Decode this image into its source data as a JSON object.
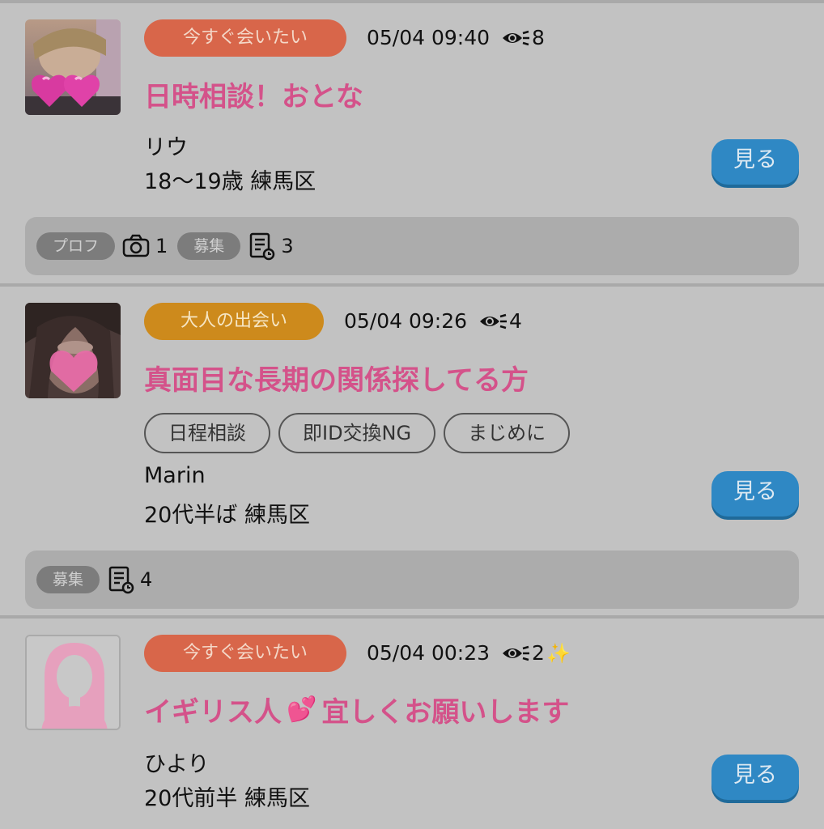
{
  "posts": [
    {
      "avatar": "photo-hearts-avatar",
      "category": "今すぐ会いたい",
      "datetime": "05/04 09:40",
      "views": "8",
      "title": "日時相談！おとな",
      "tags": [],
      "name": "リウ",
      "sub": "18〜19歳 練馬区",
      "button": "見る",
      "footer": {
        "profile_label": "プロフ",
        "photo_count": "1",
        "recruit_label": "募集",
        "post_count": "3"
      }
    },
    {
      "avatar": "photo-heart-avatar",
      "category": "大人の出会い",
      "datetime": "05/04 09:26",
      "views": "4",
      "title": "真面目な長期の関係探してる方",
      "tags": [
        "日程相談",
        "即ID交換NG",
        "まじめに"
      ],
      "name": "Marin",
      "sub": "20代半ば 練馬区",
      "button": "見る",
      "footer": {
        "recruit_label": "募集",
        "post_count": "4"
      }
    },
    {
      "avatar": "default-female-avatar",
      "category": "今すぐ会いたい",
      "datetime": "05/04 00:23",
      "views": "2",
      "new_mark": "✨",
      "title_part1": "イギリス人",
      "title_emoji": "💕",
      "title_part2": "宜しくお願いします",
      "name": "ひより",
      "sub": "20代前半 練馬区",
      "button": "見る"
    }
  ],
  "colors": {
    "background": "#c2c2c2",
    "title_pink": "#d4528a",
    "category_now": "#d8664a",
    "category_adult": "#cd8a1c",
    "button_blue": "#2f88c4"
  }
}
